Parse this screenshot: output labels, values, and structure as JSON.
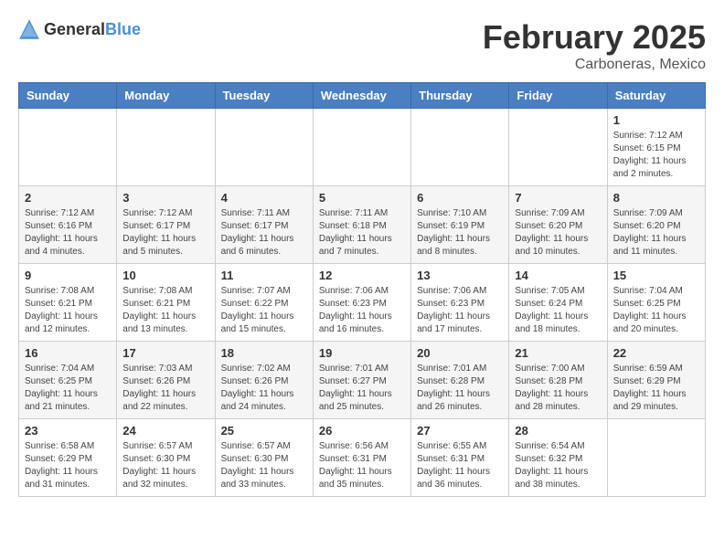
{
  "header": {
    "logo_general": "General",
    "logo_blue": "Blue",
    "title": "February 2025",
    "subtitle": "Carboneras, Mexico"
  },
  "days_of_week": [
    "Sunday",
    "Monday",
    "Tuesday",
    "Wednesday",
    "Thursday",
    "Friday",
    "Saturday"
  ],
  "weeks": [
    [
      {
        "day": "",
        "info": ""
      },
      {
        "day": "",
        "info": ""
      },
      {
        "day": "",
        "info": ""
      },
      {
        "day": "",
        "info": ""
      },
      {
        "day": "",
        "info": ""
      },
      {
        "day": "",
        "info": ""
      },
      {
        "day": "1",
        "info": "Sunrise: 7:12 AM\nSunset: 6:15 PM\nDaylight: 11 hours\nand 2 minutes."
      }
    ],
    [
      {
        "day": "2",
        "info": "Sunrise: 7:12 AM\nSunset: 6:16 PM\nDaylight: 11 hours\nand 4 minutes."
      },
      {
        "day": "3",
        "info": "Sunrise: 7:12 AM\nSunset: 6:17 PM\nDaylight: 11 hours\nand 5 minutes."
      },
      {
        "day": "4",
        "info": "Sunrise: 7:11 AM\nSunset: 6:17 PM\nDaylight: 11 hours\nand 6 minutes."
      },
      {
        "day": "5",
        "info": "Sunrise: 7:11 AM\nSunset: 6:18 PM\nDaylight: 11 hours\nand 7 minutes."
      },
      {
        "day": "6",
        "info": "Sunrise: 7:10 AM\nSunset: 6:19 PM\nDaylight: 11 hours\nand 8 minutes."
      },
      {
        "day": "7",
        "info": "Sunrise: 7:09 AM\nSunset: 6:20 PM\nDaylight: 11 hours\nand 10 minutes."
      },
      {
        "day": "8",
        "info": "Sunrise: 7:09 AM\nSunset: 6:20 PM\nDaylight: 11 hours\nand 11 minutes."
      }
    ],
    [
      {
        "day": "9",
        "info": "Sunrise: 7:08 AM\nSunset: 6:21 PM\nDaylight: 11 hours\nand 12 minutes."
      },
      {
        "day": "10",
        "info": "Sunrise: 7:08 AM\nSunset: 6:21 PM\nDaylight: 11 hours\nand 13 minutes."
      },
      {
        "day": "11",
        "info": "Sunrise: 7:07 AM\nSunset: 6:22 PM\nDaylight: 11 hours\nand 15 minutes."
      },
      {
        "day": "12",
        "info": "Sunrise: 7:06 AM\nSunset: 6:23 PM\nDaylight: 11 hours\nand 16 minutes."
      },
      {
        "day": "13",
        "info": "Sunrise: 7:06 AM\nSunset: 6:23 PM\nDaylight: 11 hours\nand 17 minutes."
      },
      {
        "day": "14",
        "info": "Sunrise: 7:05 AM\nSunset: 6:24 PM\nDaylight: 11 hours\nand 18 minutes."
      },
      {
        "day": "15",
        "info": "Sunrise: 7:04 AM\nSunset: 6:25 PM\nDaylight: 11 hours\nand 20 minutes."
      }
    ],
    [
      {
        "day": "16",
        "info": "Sunrise: 7:04 AM\nSunset: 6:25 PM\nDaylight: 11 hours\nand 21 minutes."
      },
      {
        "day": "17",
        "info": "Sunrise: 7:03 AM\nSunset: 6:26 PM\nDaylight: 11 hours\nand 22 minutes."
      },
      {
        "day": "18",
        "info": "Sunrise: 7:02 AM\nSunset: 6:26 PM\nDaylight: 11 hours\nand 24 minutes."
      },
      {
        "day": "19",
        "info": "Sunrise: 7:01 AM\nSunset: 6:27 PM\nDaylight: 11 hours\nand 25 minutes."
      },
      {
        "day": "20",
        "info": "Sunrise: 7:01 AM\nSunset: 6:28 PM\nDaylight: 11 hours\nand 26 minutes."
      },
      {
        "day": "21",
        "info": "Sunrise: 7:00 AM\nSunset: 6:28 PM\nDaylight: 11 hours\nand 28 minutes."
      },
      {
        "day": "22",
        "info": "Sunrise: 6:59 AM\nSunset: 6:29 PM\nDaylight: 11 hours\nand 29 minutes."
      }
    ],
    [
      {
        "day": "23",
        "info": "Sunrise: 6:58 AM\nSunset: 6:29 PM\nDaylight: 11 hours\nand 31 minutes."
      },
      {
        "day": "24",
        "info": "Sunrise: 6:57 AM\nSunset: 6:30 PM\nDaylight: 11 hours\nand 32 minutes."
      },
      {
        "day": "25",
        "info": "Sunrise: 6:57 AM\nSunset: 6:30 PM\nDaylight: 11 hours\nand 33 minutes."
      },
      {
        "day": "26",
        "info": "Sunrise: 6:56 AM\nSunset: 6:31 PM\nDaylight: 11 hours\nand 35 minutes."
      },
      {
        "day": "27",
        "info": "Sunrise: 6:55 AM\nSunset: 6:31 PM\nDaylight: 11 hours\nand 36 minutes."
      },
      {
        "day": "28",
        "info": "Sunrise: 6:54 AM\nSunset: 6:32 PM\nDaylight: 11 hours\nand 38 minutes."
      },
      {
        "day": "",
        "info": ""
      }
    ]
  ]
}
